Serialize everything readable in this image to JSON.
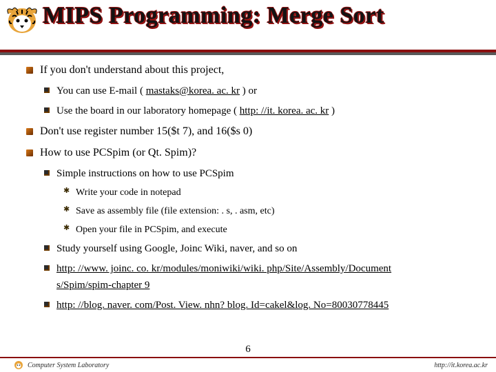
{
  "title": "MIPS Programming: Merge Sort",
  "bullets": {
    "b1": "If you don't understand about this project,",
    "b1_1_pre": "You can use E-mail ( ",
    "b1_1_link": "mastaks@korea. ac. kr",
    "b1_1_post": " ) or",
    "b1_2_pre": "Use the board in our laboratory homepage ( ",
    "b1_2_link": "http: //it. korea. ac. kr",
    "b1_2_post": " )",
    "b2": "Don't use register number 15($t 7), and 16($s 0)",
    "b3": "How to use PCSpim (or Qt. Spim)?",
    "b3_1": "Simple instructions on how to use PCSpim",
    "b3_1_1": "Write your code in notepad",
    "b3_1_2": "Save as assembly file (file extension: . s, . asm, etc)",
    "b3_1_3": "Open your file in PCSpim, and execute",
    "b3_2": "Study yourself using Google, Joinc Wiki, naver, and so on",
    "b3_3a": "http: //www. joinc. co. kr/modules/moniwiki/wiki. php/Site/Assembly/Document",
    "b3_3b": "s/Spim/spim-chapter 9",
    "b3_4": "http: //blog. naver. com/Post. View. nhn? blog. Id=cakel&log. No=80030778445"
  },
  "footer": {
    "left": "Computer System Laboratory",
    "right": "http://it.korea.ac.kr"
  },
  "page": "6"
}
